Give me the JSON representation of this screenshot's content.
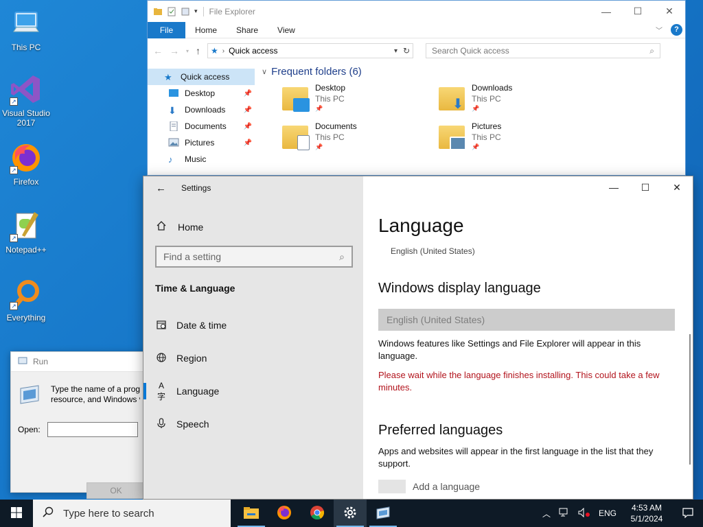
{
  "desktop": {
    "icons": [
      {
        "label": "This PC",
        "icon": "this-pc-icon"
      },
      {
        "label": "Visual Studio 2017",
        "icon": "visual-studio-icon"
      },
      {
        "label": "Firefox",
        "icon": "firefox-icon"
      },
      {
        "label": "Notepad++",
        "icon": "notepadpp-icon"
      },
      {
        "label": "Everything",
        "icon": "everything-icon"
      }
    ]
  },
  "file_explorer": {
    "title": "File Explorer",
    "ribbon_tabs": [
      "File",
      "Home",
      "Share",
      "View"
    ],
    "address": "Quick access",
    "search_placeholder": "Search Quick access",
    "nav": [
      {
        "label": "Quick access",
        "icon": "star-icon"
      },
      {
        "label": "Desktop",
        "icon": "desktop-icon"
      },
      {
        "label": "Downloads",
        "icon": "download-icon"
      },
      {
        "label": "Documents",
        "icon": "documents-icon"
      },
      {
        "label": "Pictures",
        "icon": "pictures-icon"
      },
      {
        "label": "Music",
        "icon": "music-icon"
      }
    ],
    "group_header": "Frequent folders (6)",
    "folders": [
      {
        "name": "Desktop",
        "location": "This PC"
      },
      {
        "name": "Downloads",
        "location": "This PC"
      },
      {
        "name": "Documents",
        "location": "This PC"
      },
      {
        "name": "Pictures",
        "location": "This PC"
      }
    ]
  },
  "run_dialog": {
    "title": "Run",
    "description_line1": "Type the name of a prog",
    "description_line2": "resource, and Windows v",
    "open_label": "Open:",
    "ok_label": "OK"
  },
  "settings": {
    "title": "Settings",
    "home_label": "Home",
    "search_placeholder": "Find a setting",
    "section_title": "Time & Language",
    "nav": [
      {
        "label": "Date & time",
        "icon": "calendar-icon"
      },
      {
        "label": "Region",
        "icon": "globe-icon"
      },
      {
        "label": "Language",
        "icon": "language-icon"
      },
      {
        "label": "Speech",
        "icon": "microphone-icon"
      }
    ],
    "page_title": "Language",
    "current_language": "English (United States)",
    "display_language_heading": "Windows display language",
    "display_language_value": "English (United States)",
    "display_language_desc": "Windows features like Settings and File Explorer will appear in this language.",
    "warning": "Please wait while the language finishes installing. This could take a few minutes.",
    "preferred_heading": "Preferred languages",
    "preferred_desc": "Apps and websites will appear in the first language in the list that they support.",
    "add_language": "Add a language"
  },
  "taskbar": {
    "search_placeholder": "Type here to search",
    "apps": [
      "file-explorer-icon",
      "firefox-icon",
      "chrome-icon",
      "settings-icon",
      "run-icon"
    ],
    "language": "ENG",
    "time": "4:53 AM",
    "date": "5/1/2024"
  },
  "colors": {
    "accent": "#0078d7",
    "warning": "#b2131c",
    "desktop": "#1676c8"
  }
}
